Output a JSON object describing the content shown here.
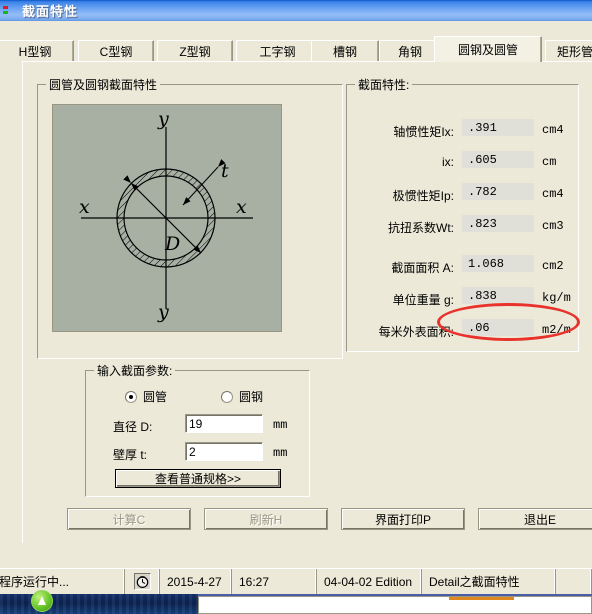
{
  "window": {
    "title": "截面特性",
    "icon": "app-icon"
  },
  "tabs": [
    {
      "label": "H型钢",
      "selected": false
    },
    {
      "label": "C型钢",
      "selected": false
    },
    {
      "label": "Z型钢",
      "selected": false
    },
    {
      "label": "工字钢",
      "selected": false
    },
    {
      "label": "槽钢",
      "selected": false
    },
    {
      "label": "角钢",
      "selected": false
    },
    {
      "label": "圆钢及圆管",
      "selected": true
    },
    {
      "label": "矩形管",
      "selected": false
    }
  ],
  "left_group": {
    "title": "圆管及圆钢截面特性",
    "diagram": {
      "name": "circular-tube-cross-section-diagram",
      "labels": {
        "y_top": "y",
        "y_bottom": "y",
        "x_left": "x",
        "x_right": "x",
        "diameter": "D",
        "thickness": "t"
      }
    }
  },
  "input_group": {
    "title": "输入截面参数:",
    "radios": [
      {
        "label": "圆管",
        "selected": true
      },
      {
        "label": "圆钢",
        "selected": false
      }
    ],
    "fields": [
      {
        "label": "直径 D:",
        "value": "19",
        "unit": "mm"
      },
      {
        "label": "壁厚 t:",
        "value": "2",
        "unit": "mm"
      }
    ],
    "spec_button": "查看普通规格>>"
  },
  "results_group": {
    "title": "截面特性:",
    "rows": [
      {
        "label": "轴惯性矩Ix:",
        "value": ".391",
        "unit": "cm4"
      },
      {
        "label": "ix:",
        "value": ".605",
        "unit": "cm"
      },
      {
        "label": "极惯性矩Ip:",
        "value": ".782",
        "unit": "cm4"
      },
      {
        "label": "抗扭系数Wt:",
        "value": ".823",
        "unit": "cm3"
      },
      {
        "label": "截面面积 A:",
        "value": "1.068",
        "unit": "cm2"
      },
      {
        "label": "单位重量 g:",
        "value": ".838",
        "unit": "kg/m"
      },
      {
        "label": "每米外表面积:",
        "value": ".06",
        "unit": "m2/m"
      }
    ],
    "highlight_row_index": 5,
    "highlight_color": "#e8322b"
  },
  "footer_buttons": [
    {
      "label": "计算C",
      "accel": "C",
      "enabled": false
    },
    {
      "label": "刷新H",
      "accel": "H",
      "enabled": false
    },
    {
      "label": "界面打印P",
      "accel": "P",
      "enabled": true
    },
    {
      "label": "退出E",
      "accel": "E",
      "enabled": true
    }
  ],
  "status_bar": {
    "running": "程序运行中...",
    "clock_icon": "clock-icon",
    "date": "2015-4-27",
    "time": "16:27",
    "edition": "04-04-02 Edition",
    "module": "Detail之截面特性"
  }
}
